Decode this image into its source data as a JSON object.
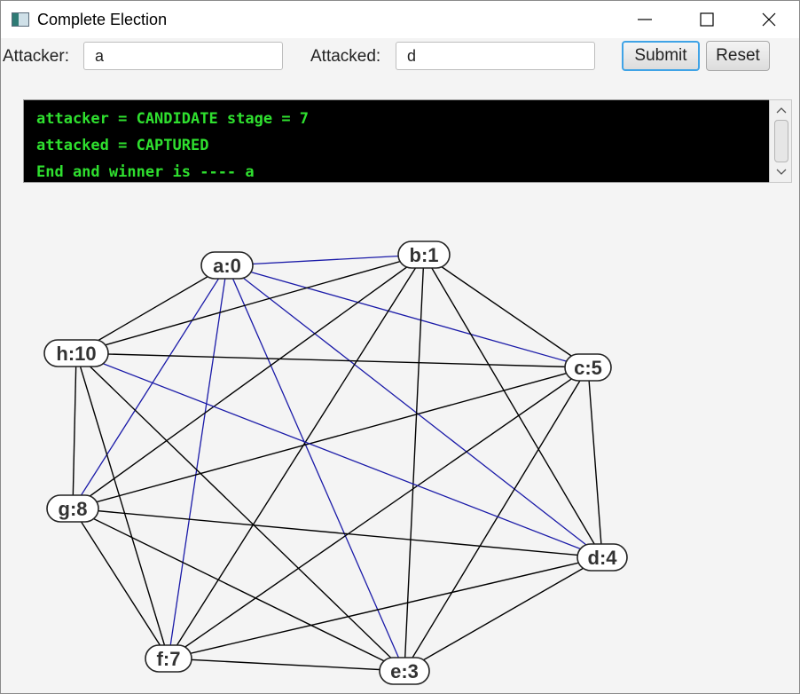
{
  "window": {
    "title": "Complete Election",
    "icon": "app-window-icon"
  },
  "form": {
    "attacker_label": "Attacker:",
    "attacker_value": "a",
    "attacked_label": "Attacked:",
    "attacked_value": "d",
    "submit_label": "Submit",
    "reset_label": "Reset"
  },
  "console": {
    "lines": [
      "attacker = CANDIDATE stage = 7",
      "attacked = CAPTURED",
      "End and winner is ---- a"
    ],
    "text_color": "#2fe02f",
    "background": "#000000"
  },
  "graph": {
    "nodes": [
      {
        "id": "a",
        "label": "a:0"
      },
      {
        "id": "b",
        "label": "b:1"
      },
      {
        "id": "c",
        "label": "c:5"
      },
      {
        "id": "d",
        "label": "d:4"
      },
      {
        "id": "e",
        "label": "e:3"
      },
      {
        "id": "f",
        "label": "f:7"
      },
      {
        "id": "g",
        "label": "g:8"
      },
      {
        "id": "h",
        "label": "h:10"
      }
    ],
    "highlighted_edges": [
      [
        "b",
        "a"
      ],
      [
        "c",
        "a"
      ],
      [
        "d",
        "a"
      ],
      [
        "e",
        "a"
      ],
      [
        "f",
        "a"
      ],
      [
        "g",
        "a"
      ],
      [
        "h",
        "d"
      ]
    ],
    "edge_colors": {
      "normal": "#000000",
      "highlight": "#1a1aa8"
    }
  }
}
